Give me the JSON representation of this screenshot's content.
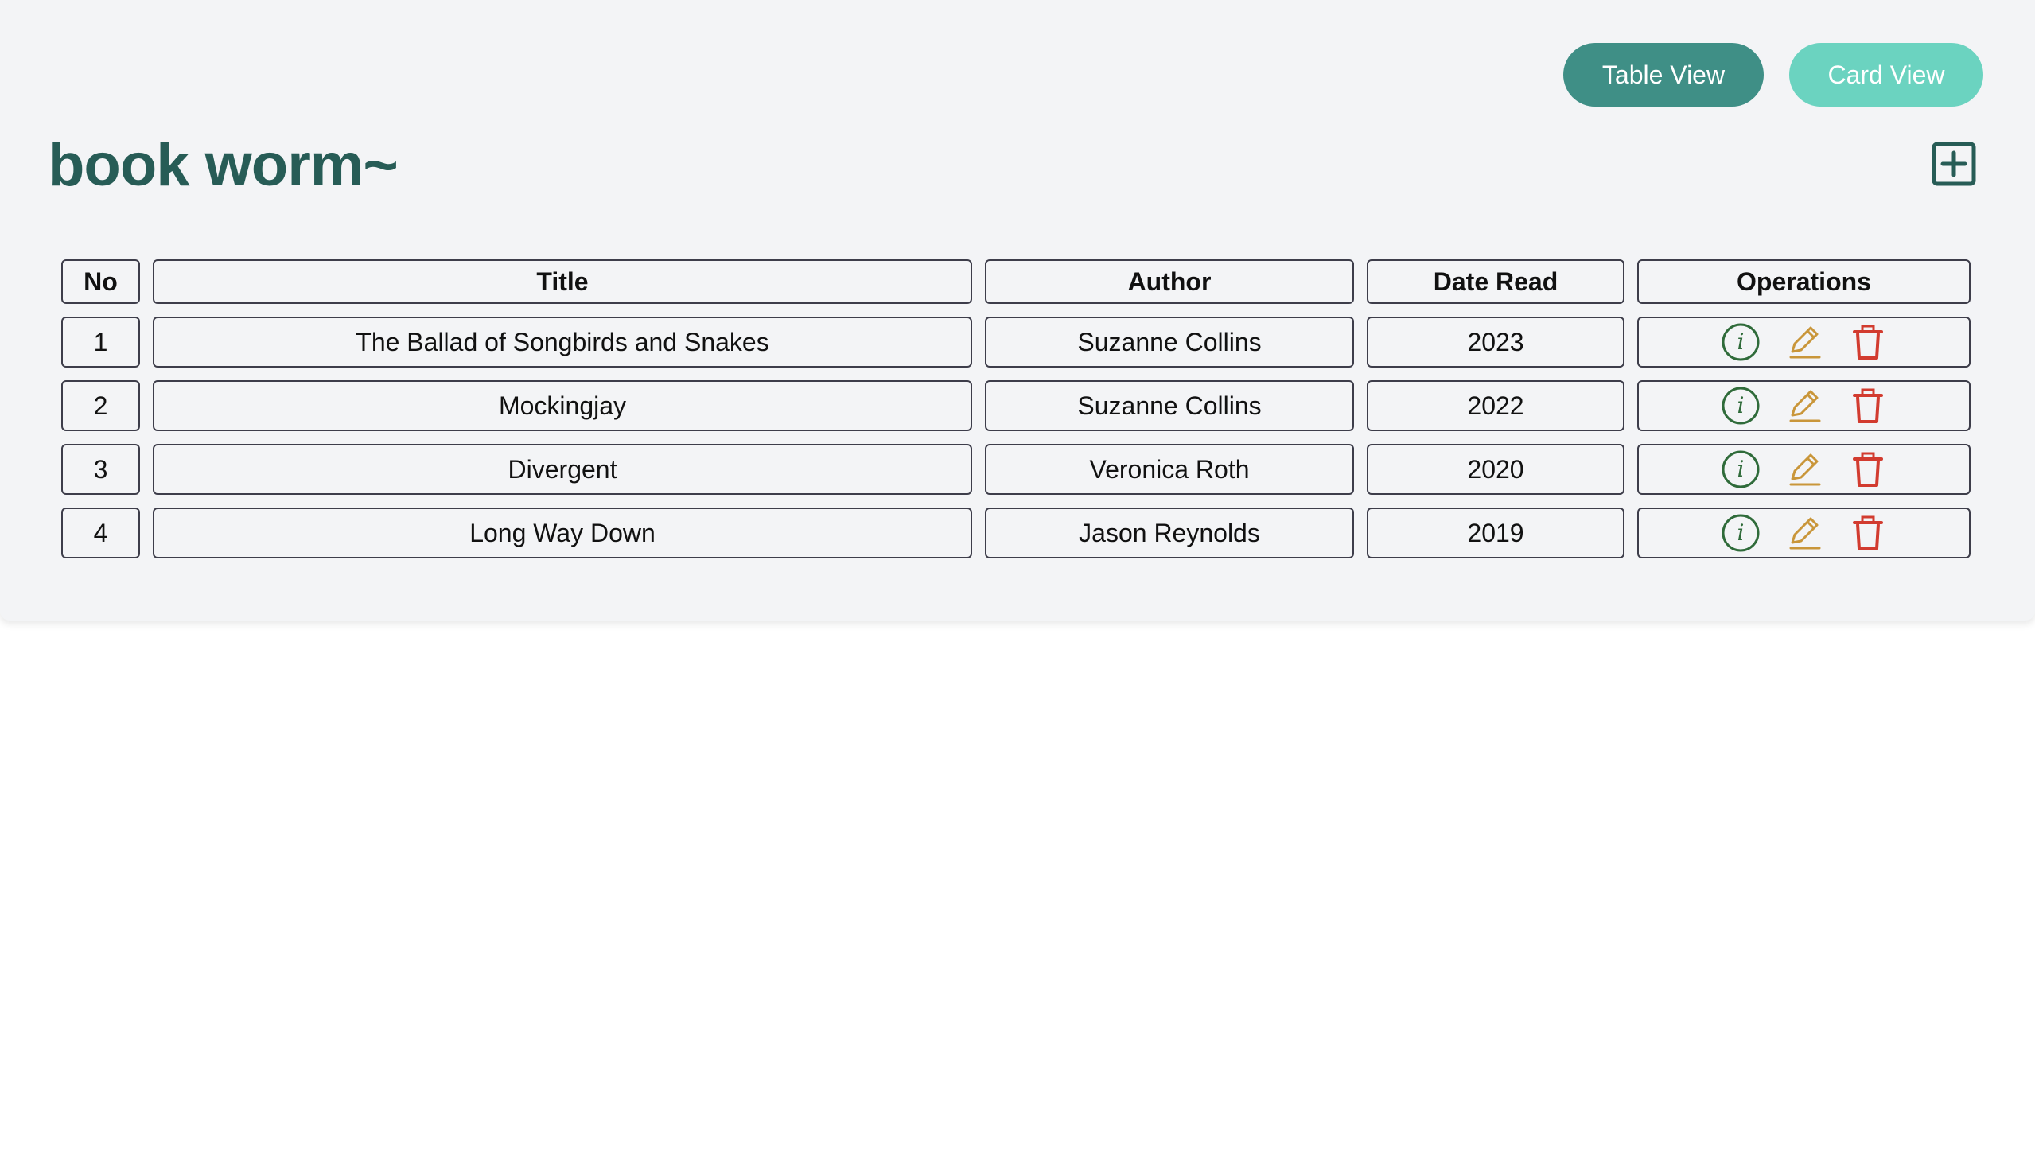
{
  "header": {
    "table_view_label": "Table View",
    "card_view_label": "Card View",
    "app_title": "book worm~"
  },
  "add_button": {
    "icon": "plus-square-icon"
  },
  "table": {
    "columns": [
      "No",
      "Title",
      "Author",
      "Date Read",
      "Operations"
    ],
    "rows": [
      {
        "no": "1",
        "title": "The Ballad of Songbirds and Snakes",
        "author": "Suzanne Collins",
        "date_read": "2023"
      },
      {
        "no": "2",
        "title": "Mockingjay",
        "author": "Suzanne Collins",
        "date_read": "2022"
      },
      {
        "no": "3",
        "title": "Divergent",
        "author": "Veronica Roth",
        "date_read": "2020"
      },
      {
        "no": "4",
        "title": "Long Way Down",
        "author": "Jason Reynolds",
        "date_read": "2019"
      }
    ],
    "operation_icons": [
      "info-circle-icon",
      "pencil-icon",
      "trash-icon"
    ]
  },
  "colors": {
    "primary": "#3f8f86",
    "primary_light": "#6bd3c0",
    "title": "#275c56",
    "info": "#2f6b3a",
    "edit": "#c9963a",
    "delete": "#d23b2f"
  }
}
